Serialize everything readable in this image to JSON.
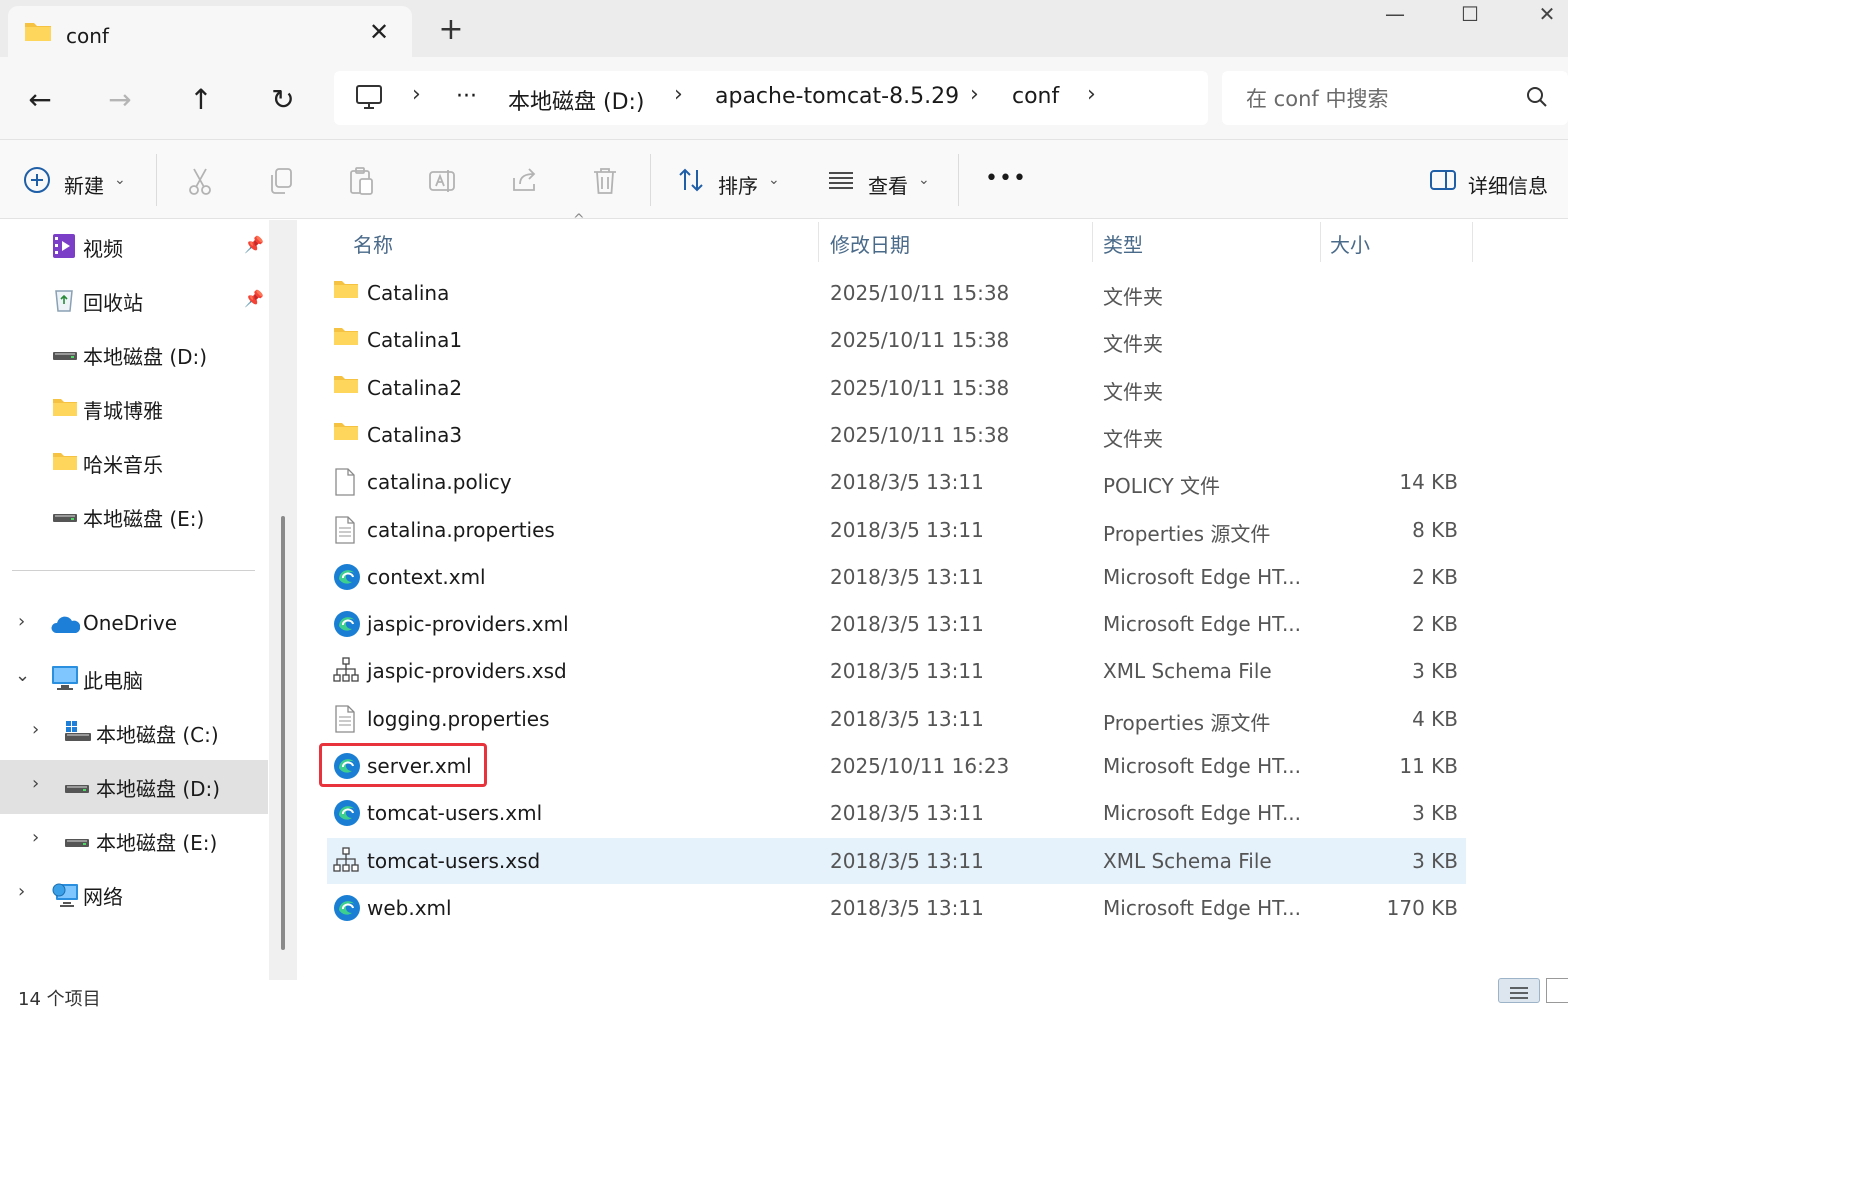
{
  "window": {
    "tab_title": "conf",
    "tab_close": "✕",
    "new_tab": "+",
    "controls": {
      "minimize": "—",
      "maximize": "☐",
      "close": "✕"
    }
  },
  "nav": {
    "back": "←",
    "forward": "→",
    "up": "↑",
    "refresh": "↻"
  },
  "address": {
    "ellipsis": "···",
    "crumbs": [
      "本地磁盘 (D:)",
      "apache-tomcat-8.5.29",
      "conf"
    ],
    "separator": "›"
  },
  "search": {
    "placeholder": "在 conf 中搜索"
  },
  "toolbar": {
    "new_label": "新建",
    "sort_label": "排序",
    "view_label": "查看",
    "more_label": "•••",
    "details_label": "详细信息",
    "dropdown": "⌄"
  },
  "sidebar": {
    "items": [
      {
        "label": "视频",
        "icon": "video-icon",
        "pinned": true
      },
      {
        "label": "回收站",
        "icon": "recycle-bin-icon",
        "pinned": true
      },
      {
        "label": "本地磁盘 (D:)",
        "icon": "drive-icon"
      },
      {
        "label": "青城博雅",
        "icon": "folder-icon"
      },
      {
        "label": "哈米音乐",
        "icon": "folder-icon"
      },
      {
        "label": "本地磁盘 (E:)",
        "icon": "drive-icon"
      }
    ],
    "tree": [
      {
        "label": "OneDrive",
        "icon": "onedrive-icon",
        "expander": "›"
      },
      {
        "label": "此电脑",
        "icon": "pc-icon",
        "expander": "⌄"
      },
      {
        "label": "本地磁盘 (C:)",
        "icon": "windows-drive-icon",
        "expander": "›"
      },
      {
        "label": "本地磁盘 (D:)",
        "icon": "drive-icon",
        "expander": "›",
        "selected": true
      },
      {
        "label": "本地磁盘 (E:)",
        "icon": "drive-icon",
        "expander": "›"
      },
      {
        "label": "网络",
        "icon": "network-icon",
        "expander": "›"
      }
    ]
  },
  "files": {
    "columns": {
      "name": "名称",
      "date": "修改日期",
      "type": "类型",
      "size": "大小"
    },
    "rows": [
      {
        "name": "Catalina",
        "date": "2025/10/11 15:38",
        "type": "文件夹",
        "size": "",
        "icon": "folder-icon"
      },
      {
        "name": "Catalina1",
        "date": "2025/10/11 15:38",
        "type": "文件夹",
        "size": "",
        "icon": "folder-icon"
      },
      {
        "name": "Catalina2",
        "date": "2025/10/11 15:38",
        "type": "文件夹",
        "size": "",
        "icon": "folder-icon"
      },
      {
        "name": "Catalina3",
        "date": "2025/10/11 15:38",
        "type": "文件夹",
        "size": "",
        "icon": "folder-icon"
      },
      {
        "name": "catalina.policy",
        "date": "2018/3/5 13:11",
        "type": "POLICY 文件",
        "size": "14 KB",
        "icon": "blank-file-icon"
      },
      {
        "name": "catalina.properties",
        "date": "2018/3/5 13:11",
        "type": "Properties 源文件",
        "size": "8 KB",
        "icon": "text-file-icon"
      },
      {
        "name": "context.xml",
        "date": "2018/3/5 13:11",
        "type": "Microsoft Edge HT...",
        "size": "2 KB",
        "icon": "edge-icon"
      },
      {
        "name": "jaspic-providers.xml",
        "date": "2018/3/5 13:11",
        "type": "Microsoft Edge HT...",
        "size": "2 KB",
        "icon": "edge-icon"
      },
      {
        "name": "jaspic-providers.xsd",
        "date": "2018/3/5 13:11",
        "type": "XML Schema File",
        "size": "3 KB",
        "icon": "schema-icon"
      },
      {
        "name": "logging.properties",
        "date": "2018/3/5 13:11",
        "type": "Properties 源文件",
        "size": "4 KB",
        "icon": "text-file-icon"
      },
      {
        "name": "server.xml",
        "date": "2025/10/11 16:23",
        "type": "Microsoft Edge HT...",
        "size": "11 KB",
        "icon": "edge-icon",
        "highlighted": true
      },
      {
        "name": "tomcat-users.xml",
        "date": "2018/3/5 13:11",
        "type": "Microsoft Edge HT...",
        "size": "3 KB",
        "icon": "edge-icon"
      },
      {
        "name": "tomcat-users.xsd",
        "date": "2018/3/5 13:11",
        "type": "XML Schema File",
        "size": "3 KB",
        "icon": "schema-icon",
        "hover": true
      },
      {
        "name": "web.xml",
        "date": "2018/3/5 13:11",
        "type": "Microsoft Edge HT...",
        "size": "170 KB",
        "icon": "edge-icon"
      }
    ]
  },
  "status": {
    "item_count": "14 个项目"
  },
  "colors": {
    "highlight_box": "#e8323c",
    "hover_row": "#e5f1fb",
    "folder": "#f5c242",
    "edge_blue": "#1a7fd4"
  }
}
